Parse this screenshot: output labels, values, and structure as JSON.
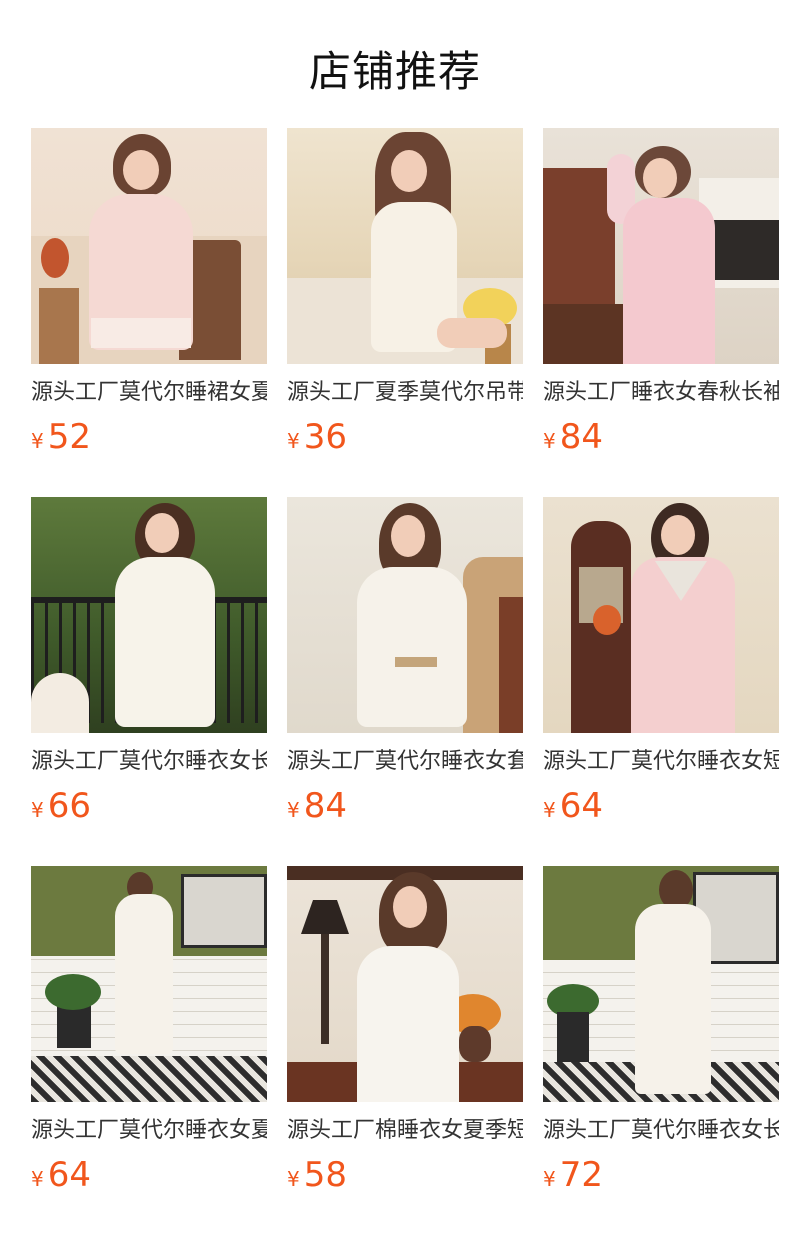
{
  "section": {
    "title": "店铺推荐"
  },
  "products": [
    {
      "name": "源头工厂莫代尔睡裙女夏季",
      "currency": "¥",
      "price": "52",
      "scene": "pink-dress-chair"
    },
    {
      "name": "源头工厂夏季莫代尔吊带睡裙",
      "currency": "¥",
      "price": "36",
      "scene": "white-slip-flowers"
    },
    {
      "name": "源头工厂睡衣女春秋长袖套装",
      "currency": "¥",
      "price": "84",
      "scene": "pink-set-fireplace"
    },
    {
      "name": "源头工厂莫代尔睡衣女长袖",
      "currency": "¥",
      "price": "66",
      "scene": "white-gown-garden"
    },
    {
      "name": "源头工厂莫代尔睡衣女套装",
      "currency": "¥",
      "price": "84",
      "scene": "white-set-chair"
    },
    {
      "name": "源头工厂莫代尔睡衣女短袖",
      "currency": "¥",
      "price": "64",
      "scene": "pink-gown-cabinet"
    },
    {
      "name": "源头工厂莫代尔睡衣女夏季",
      "currency": "¥",
      "price": "64",
      "scene": "white-gown-bathroom"
    },
    {
      "name": "源头工厂棉睡衣女夏季短袖",
      "currency": "¥",
      "price": "58",
      "scene": "white-gown-lamp"
    },
    {
      "name": "源头工厂莫代尔睡衣女长袖",
      "currency": "¥",
      "price": "72",
      "scene": "white-gown-bathroom-2"
    }
  ]
}
